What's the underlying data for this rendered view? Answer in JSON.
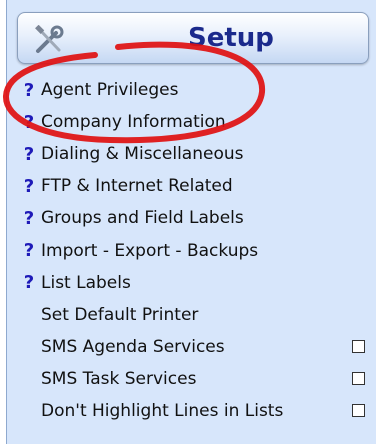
{
  "header": {
    "title": "Setup",
    "icon": "tools-icon"
  },
  "menu": {
    "items": [
      {
        "label": "Agent Privileges",
        "has_help": true,
        "help": "?"
      },
      {
        "label": "Company Information",
        "has_help": true,
        "help": "?"
      },
      {
        "label": "Dialing & Miscellaneous",
        "has_help": true,
        "help": "?"
      },
      {
        "label": "FTP & Internet Related",
        "has_help": true,
        "help": "?"
      },
      {
        "label": "Groups and Field Labels",
        "has_help": true,
        "help": "?"
      },
      {
        "label": "Import - Export - Backups",
        "has_help": true,
        "help": "?"
      },
      {
        "label": "List Labels",
        "has_help": true,
        "help": "?"
      },
      {
        "label": "Set Default Printer",
        "has_help": false
      },
      {
        "label": "SMS Agenda Services",
        "has_help": false,
        "checkbox": true,
        "checked": false
      },
      {
        "label": "SMS Task Services",
        "has_help": false,
        "checkbox": true,
        "checked": false
      },
      {
        "label": "Don't Highlight Lines in Lists",
        "has_help": false,
        "checkbox": true,
        "checked": false
      }
    ]
  },
  "colors": {
    "panel_bg": "#d7e6fb",
    "title": "#1b2a8c",
    "help_icon": "#1e1ab8",
    "annotation_ring": "#e01010"
  }
}
